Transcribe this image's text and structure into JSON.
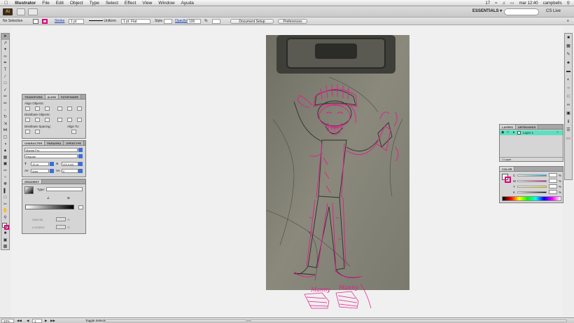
{
  "menubar": {
    "apple": "",
    "app_name": "Illustrator",
    "items": [
      "File",
      "Edit",
      "Object",
      "Type",
      "Select",
      "Effect",
      "View",
      "Window",
      "Ayuda"
    ],
    "status": {
      "badge": "17",
      "clock": "mar 12:40",
      "user": "campbells"
    }
  },
  "appbar": {
    "logo": "Ai",
    "workspace": "ESSENTIALS",
    "cs_live": "CS Live"
  },
  "controlbar": {
    "selection": "No Selection",
    "stroke_label": "Stroke",
    "stroke_weight": "1 pt",
    "profile": "Uniform",
    "brush": "1 pt. Flat",
    "style_label": "Style",
    "opacity_label": "Opacity",
    "opacity_value": "100",
    "opacity_unit": "%",
    "doc_setup": "Document Setup",
    "preferences": "Preferences",
    "fill_color": "#ffffff",
    "stroke_color": "#e0007a"
  },
  "align_panel": {
    "tabs": [
      "TRANSFORM",
      "ALIGN",
      "PATHFINDER"
    ],
    "align_objects": "Align Objects:",
    "distribute_objects": "Distribute Objects:",
    "distribute_spacing": "Distribute Spacing:",
    "align_to": "Align To:"
  },
  "character_panel": {
    "tabs": [
      "CHARACTER",
      "PARAGRA",
      "OPENTYPE"
    ],
    "font": "Myriad Pro",
    "style": "Regular",
    "size": "12 pt",
    "leading": "(14,4 pt)",
    "kerning": "Auto",
    "tracking": "0"
  },
  "gradient_panel": {
    "title": "GRADIENT",
    "type_label": "Type:",
    "opacity_label": "Opacity:",
    "location_label": "Location:",
    "pct": "%"
  },
  "layers_panel": {
    "tabs": [
      "LAYERS",
      "ARTBOARDS"
    ],
    "layer_name": "Layer 1",
    "footer": "1 Layer"
  },
  "color_panel": {
    "title": "COLOR",
    "channels": [
      "C",
      "M",
      "Y",
      "K"
    ],
    "pct": "%"
  },
  "statusbar": {
    "zoom": "33%",
    "artboard_num": "1",
    "status": "Toggle Selection"
  },
  "artwork": {
    "signature_1": "Manny",
    "signature_2": "Manny"
  }
}
